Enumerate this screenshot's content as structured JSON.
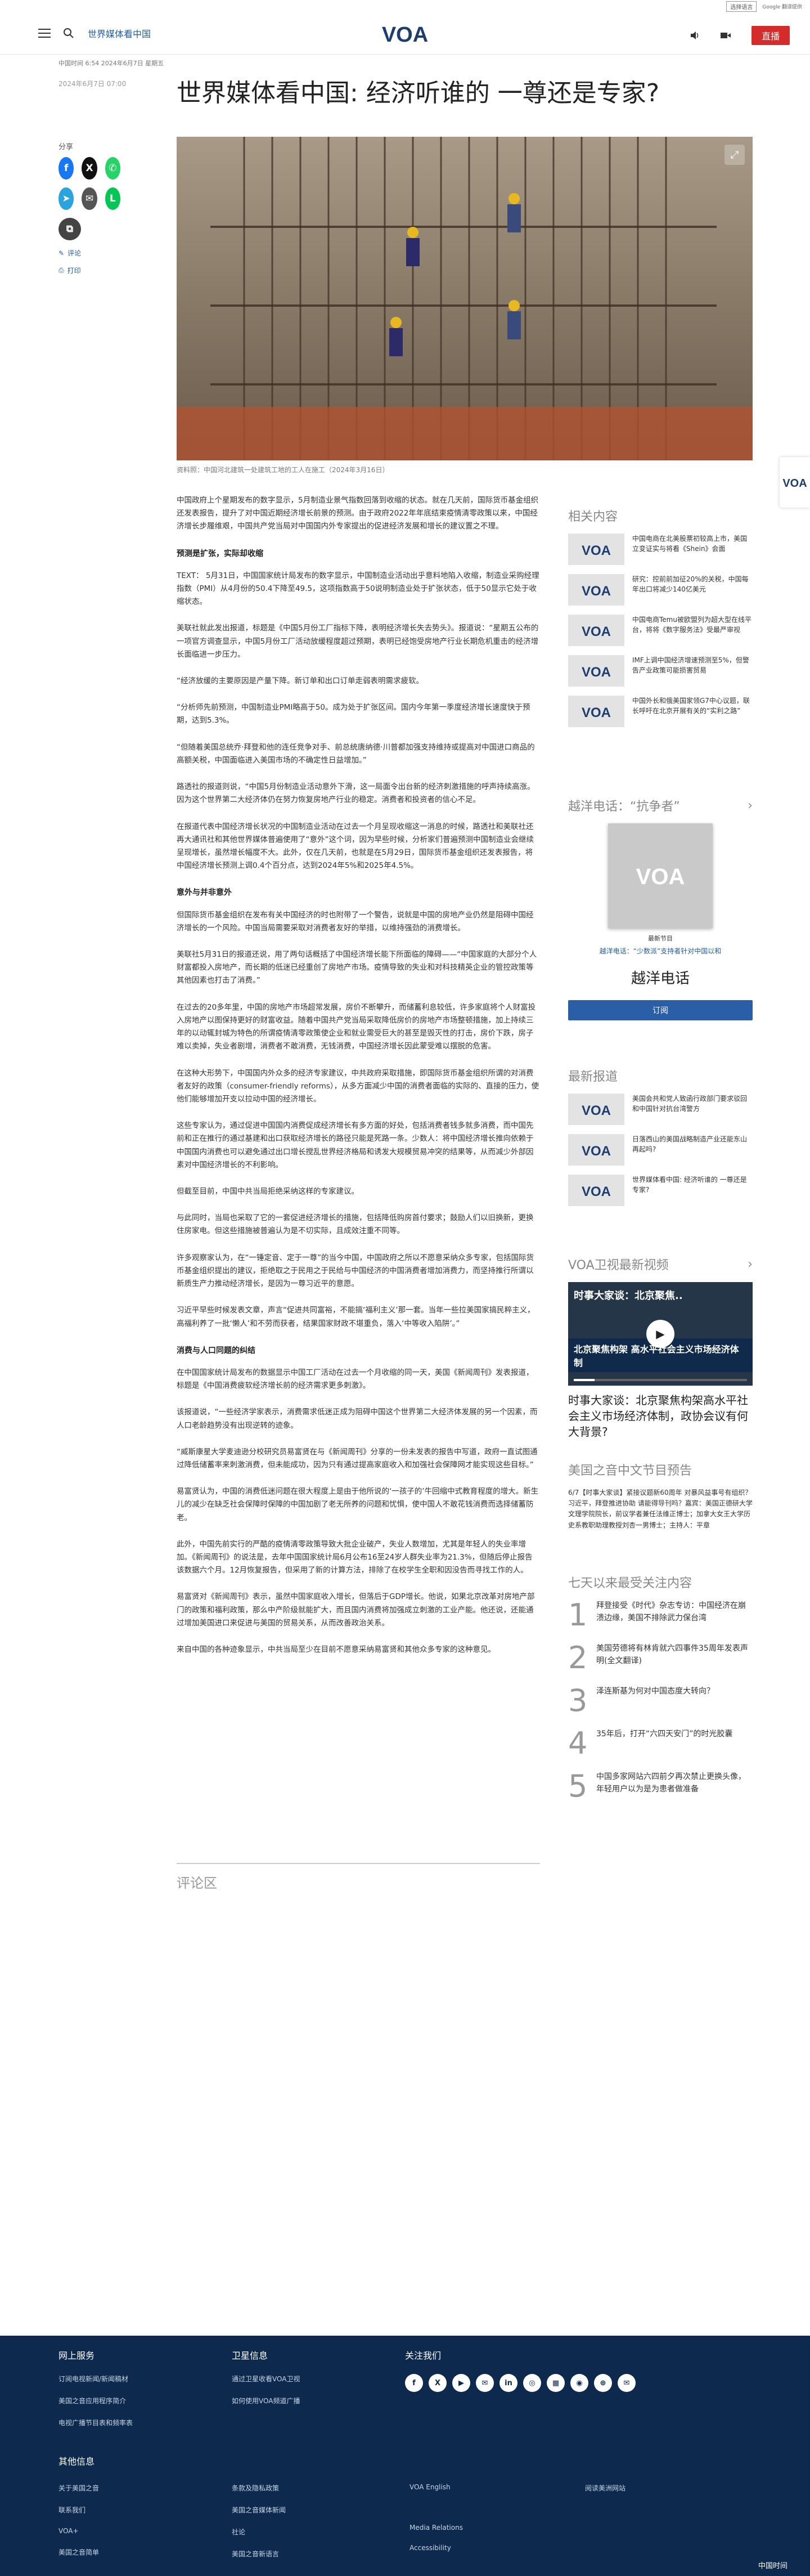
{
  "topbar": {
    "language": "选择语言",
    "gt": "Google 翻译提供"
  },
  "header": {
    "section": "世界媒体看中国",
    "live": "直播"
  },
  "article": {
    "meta": "中国时间 6:54 2024年6月7日 星期五",
    "date": "2024年6月7日 07:00",
    "title": "世界媒体看中国: 经济听谁的 一尊还是专家?",
    "caption": "资料照：中国河北建筑一处建筑工地的工人在施工（2024年3月16日）",
    "paragraphs": [
      {
        "t": "p",
        "text": "中国政府上个星期发布的数字显示，5月制造业景气指数回落到收缩的状态。就在几天前，国际货币基金组织还发表报告，提升了对中国近期经济增长前景的预测。由于政府2022年年底结束疫情清零政策以来，中国经济增长步履维艰，中国共产党当局对中国国内外专家提出的促进经济发展和增长的建议置之不理。"
      },
      {
        "t": "h",
        "text": "预测是扩张，实际却收缩"
      },
      {
        "t": "p",
        "text": "TEXT： 5月31日，中国国家统计局发布的数字显示，中国制造业活动出乎意料地陷入收缩，制造业采购经理指数（PMI）从4月份的50.4下降至49.5，这项指数高于50说明制造业处于扩张状态，低于50显示它处于收缩状态。"
      },
      {
        "t": "p",
        "text": "美联社就此发出报道，标题是《中国5月份工厂指标下降，表明经济增长失去势头》。报道说：“星期五公布的一项官方调查显示，中国5月份工厂活动放缓程度超过预期，表明已经饱受房地产行业长期危机重击的经济增长面临进一步压力。"
      },
      {
        "t": "p",
        "text": "“经济放缓的主要原因是产量下降。新订单和出口订单走弱表明需求疲软。"
      },
      {
        "t": "p",
        "text": "“分析师先前预测，中国制造业PMI略高于50。成为处于扩张区间。国内今年第一季度经济增长速度快于预期，达到5.3%。"
      },
      {
        "t": "p",
        "text": "“但随着美国总统乔·拜登和他的连任竞争对手、前总统唐纳德·川普都加强支持维持或提高对中国进口商品的高额关税，中国面临进入美国市场的不确定性日益增加。”"
      },
      {
        "t": "p",
        "text": "路透社的报道则说，“中国5月份制造业活动意外下滑，这一局面令出台新的经济刺激措施的呼声持续高涨。因为这个世界第二大经济体仍在努力恢复房地产行业的稳定。消费者和投资者的信心不足。"
      },
      {
        "t": "p",
        "text": "在报道代表中国经济增长状况的中国制造业活动在过去一个月呈现收缩这一消息的时候，路透社和美联社还再大通讯社和其他世界媒体普遍使用了“意外”这个词，因为早些时候，分析家们普遍预测中国制造业会继续呈现增长，虽然增长幅度不大。此外，仅在几天前，也就是在5月29日，国际货币基金组织还发表报告，将中国经济增长预测上调0.4个百分点，达到2024年5%和2025年4.5%。"
      },
      {
        "t": "h",
        "text": "意外与并非意外"
      },
      {
        "t": "p",
        "text": "但国际货币基金组织在发布有关中国经济的时也附带了一个警告，说就是中国的房地产业仍然是阻碍中国经济增长的一个风险。中国当局需要采取对消费者友好的举措，以维持强劲的消费增长。"
      },
      {
        "t": "p",
        "text": "美联社5月31日的报道还说，用了两句话概括了中国经济增长能下所面临的障碍——“中国家庭的大部分个人财富都投入房地产，而长期的低迷已经重创了房地产市场。疫情导致的失业和对科技精英企业的管控政策等其他因素也打击了消费。”"
      },
      {
        "t": "p",
        "text": "在过去的20多年里，中国的房地产市场超常发展，房价不断攀升，而储蓄利息较低，许多家庭将个人财富投入房地产以图保持更好的财富收益。随着中国共产党当局采取降低房价的房地产市场整顿措施，加上持续三年的以动辄封城为特色的所谓疫情清零政策使企业和就业需受巨大的甚至是毁灭性的打击，房价下跌，房子难以卖掉，失业者剧增，消费者不敢消费，无钱消费，中国经济增长因此蒙受难以摆脱的危害。"
      },
      {
        "t": "p",
        "text": "在这种大形势下，中国国内外众多的经济专家建议，中共政府采取措施，即国际货币基金组织所谓的对消费者友好的政策（consumer-friendly reforms），从多方面减少中国的消费者面临的实际的、直接的压力，使他们能够增加开支以拉动中国的经济增长。"
      },
      {
        "t": "p",
        "text": "这些专家认为，通过促进中国国内消费促成经济增长有多方面的好处，包括消费者钱多就多消费，而中国先前和正在推行的通过基建和出口获取经济增长的路径只能是死路一条。少数人：将中国经济增长推向依赖于中国国内消费也可以避免通过出口增长搅乱世界经济格局和诱发大规模贸易冲突的结果等，从而减少外部因素对中国经济增长的不利影响。"
      },
      {
        "t": "p",
        "text": "但截至目前，中国中共当局拒绝采纳这样的专家建议。"
      },
      {
        "t": "p",
        "text": "与此同时，当局也采取了它的一套促进经济增长的措施，包括降低购房首付要求；鼓励人们以旧换新，更换住房家电。但这些措施被普遍认为是不切实际，且成效注重不同等。"
      },
      {
        "t": "p",
        "text": "许多观察家认为，在“一锤定音、定于一尊”的当今中国，中国政府之所以不愿意采纳众多专家，包括国际货币基金组织提出的建议，拒绝取之于民用之于民给与中国经济的中国消费者增加消费力，而坚持推行所谓以新质生产力推动经济增长，是因为一尊习近平的意愿。"
      },
      {
        "t": "p",
        "text": "习近平早些时候发表文章，声言“促进共同富裕，不能搞‘福利主义’那一套。当年一些拉美国家搞民粹主义，高福利养了一批‘懒人’和不劳而获者，结果国家财政不堪重负，落入‘中等收入陷阱’。”"
      },
      {
        "t": "h",
        "text": "消费与人口同题的纠结"
      },
      {
        "t": "p",
        "text": "在中国国家统计局发布的数据显示中国工厂活动在过去一个月收缩的同一天，美国《新闻周刊》发表报道，标题是《中国消费疲软经济增长前的经济需求更多刺激》。"
      },
      {
        "t": "p",
        "text": "该报道说，“一些经济学家表示，消费需求低迷正成为阻碍中国这个世界第二大经济体发展的另一个因素，而人口老龄趋势没有出现逆转的迹象。"
      },
      {
        "t": "p",
        "text": "“威斯康星大学麦迪逊分校研究员易富贤在与《新闻周刊》分享的一份未发表的报告中写道，政府一直试图通过降低储蓄率来刺激消费，但未能成功，因为只有通过提高家庭收入和加强社会保障网才能实现这些目标。”"
      },
      {
        "t": "p",
        "text": "易富贤认为，中国的消费低迷问题在很大程度上是由于他所说的‘一孩子的’牛回缩中式教育程度的增大。新生儿的减少在缺乏社会保障时保障的中国加剧了老无所养的问题和忧惧，使中国人不敢花钱消费而选择储蓄防老。"
      },
      {
        "t": "p",
        "text": "此外，中国先前实行的严酷的疫情清零政策导致大批企业破产，失业人数增加，尤其是年轻人的失业率增加。《新闻周刊》的说法是，去年中国国家统计局6月公布16至24岁人群失业率为21.3%，但随后停止报告该数据六个月。12月恢复报告，但采用了新的计算方法，排除了在校学生全职和因没告而寻找工作的人。"
      },
      {
        "t": "p",
        "text": "易富贤对《新闻周刊》表示，虽然中国家庭收入增长，但落后于GDP增长。他说，如果北京改革对房地产部门的政策和福利政策，那么中产阶级就能扩大，而且国内消费将加强成立刺激的工业产能。他还说，还能通过增加美国进口来促进与美国的贸易关系，从而改善政治关系。"
      },
      {
        "t": "p",
        "text": "来自中国的各种迹象显示，中共当局至少在目前不愿意采纳易富贤和其他众多专家的这种意见。"
      }
    ],
    "comments": "评论区"
  },
  "share": {
    "label": "分享",
    "comment": "评论",
    "print": "打印"
  },
  "sidebar": {
    "related_title": "相关内容",
    "related": [
      "中国电商在北美股票初较高上市，美国立变证实与将看《Shein》会面",
      "研究：控前前加征20%的关税，中国每年出口将减少140亿美元",
      "中国电商Temu被欧盟列为超大型在线平台，将将《数字服务法》受最严审视",
      "IMF上调中国经济增速预测至5%，但警告产业政策可能损害贸易",
      "中国外长和俄美国家领G7中心议题，联长呼吁在北京开展有关的“实利之路”"
    ],
    "podcast_title": "越洋电话：“抗争者”",
    "podcast_ep": "最新节目",
    "podcast_link": "越洋电话：“少数派”支持者针对中国以和",
    "podcast_name": "越洋电话",
    "podcast_sub": "订阅",
    "latest_title": "最新报道",
    "latest": [
      "美国会共和党人致函行政部门要求驳回和中国针对抗台湾警方",
      "日落西山的美国战略制造产业还能东山再起吗?",
      "世界媒体看中国: 经济听谁的 一尊还是专家?"
    ],
    "video_title": "VOA卫视最新视频",
    "video_overlay": "时事大家谈：北京聚焦..",
    "video_banner": "北京聚焦构架 高水平社会主义市场经济体制",
    "video_caption": "时事大家谈：北京聚焦构架高水平社会主义市场经济体制，政协会议有何大背景?",
    "radio_title": "美国之音中文节目预告",
    "radio_text": "6/7【时事大家谈】紧接议题新60周年 对暴风益事号有组织？习近平，拜登推进协助 请能得导刊吗？嘉宾：美国正德研大学文理学院院长，前议学者兼任法维正博士；加拿大女王大学历史系教职助理教授刘杏一男博士；主持人：平章",
    "popular_title": "七天以来最受关注内容",
    "popular": [
      "拜登接受《时代》杂志专访：中国经济在崩溃边缘，美国不排除武力保台湾",
      "美国劳德将有林肯就六四事件35周年发表声明(全文翻译)",
      "泽连斯基为何对中国态度大转向？",
      "35年后，打开“六四天安门”的时光胶囊",
      "中国多家网站六四前夕再次禁止更换头像，年轻用户以为是为患者做准备"
    ]
  },
  "footer": {
    "col1_title": "网上服务",
    "col1": [
      "订阅电视新闻/新闻稿材",
      "美国之音应用程序简介",
      "电视广播节目表和频率表"
    ],
    "col2_title": "卫星信息",
    "col2": [
      "通过卫星收看VOA卫视",
      "如何使用VOA频道广播"
    ],
    "col3_title": "关注我们",
    "social": [
      "f",
      "X",
      "▶",
      "✉",
      "in",
      "◎",
      "▦",
      "◉",
      "⊕",
      "✉"
    ],
    "col4_title": "其他信息",
    "col4a": [
      "关于美国之音",
      "联系我们",
      "VOA+",
      "美国之音简单"
    ],
    "col4b": [
      "条款及隐私政策",
      "美国之音媒体新闻",
      "社论",
      "美国之音新语言"
    ],
    "col4c": [
      "VOA English",
      "",
      "Media Relations",
      "Accessibility"
    ],
    "col4d": [
      "阅读美洲网站"
    ],
    "bottom": "中国时间"
  }
}
